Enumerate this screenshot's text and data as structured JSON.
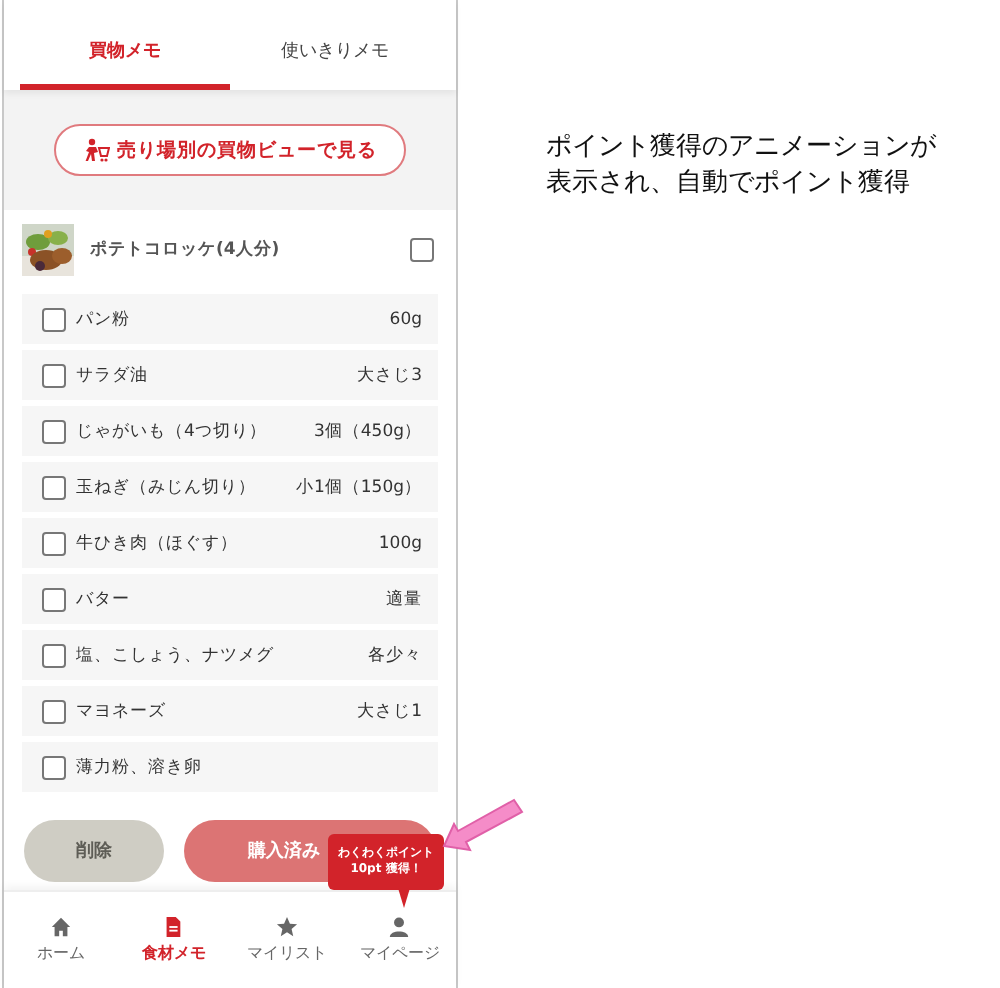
{
  "tabs": [
    {
      "label": "買物メモ",
      "selected": true
    },
    {
      "label": "使いきりメモ",
      "selected": false
    }
  ],
  "sales_floor_button": {
    "label": "売り場別の買物ビューで見る"
  },
  "recipe": {
    "kind": "picture",
    "name": "ポテトコロッケ(4人分)",
    "checked": false
  },
  "ingredients": [
    {
      "name": "パン粉",
      "amount": "60g",
      "checked": false
    },
    {
      "name": "サラダ油",
      "amount": "大さじ3",
      "checked": false
    },
    {
      "name": "じゃがいも（4つ切り）",
      "amount": "3個（450g）",
      "checked": false
    },
    {
      "name": "玉ねぎ（みじん切り）",
      "amount": "小1個（150g）",
      "checked": false
    },
    {
      "name": "牛ひき肉（ほぐす）",
      "amount": "100g",
      "checked": false
    },
    {
      "name": "バター",
      "amount": "適量",
      "checked": false
    },
    {
      "name": "塩、こしょう、ナツメグ",
      "amount": "各少々",
      "checked": false
    },
    {
      "name": "マヨネーズ",
      "amount": "大さじ1",
      "checked": false
    },
    {
      "name": "薄力粉、溶き卵",
      "checked": false
    }
  ],
  "floating_buttons": {
    "delete": "削除",
    "purchased": "購入済み"
  },
  "tooltip": {
    "line_1": "わくわくポイント",
    "line_2": "10pt 獲得！"
  },
  "bottom_nav": [
    {
      "label": "ホーム",
      "selected": false
    },
    {
      "label": "食材メモ",
      "selected": true
    },
    {
      "label": "マイリスト",
      "selected": false
    },
    {
      "label": "マイページ",
      "selected": false
    }
  ],
  "annotation": {
    "lines": [
      "ポイント獲得のアニメーションが",
      "表示され、自動でポイント獲得"
    ]
  }
}
